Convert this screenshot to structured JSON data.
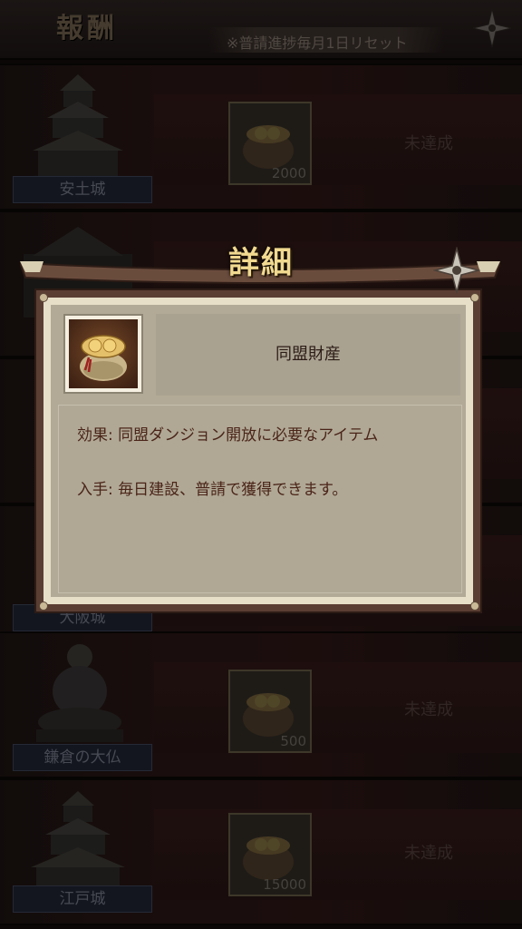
{
  "header": {
    "title": "報酬",
    "notice": "※普請進捗毎月1日リセット"
  },
  "rewards": [
    {
      "place": "安土城",
      "count": "2000",
      "status": "未達成"
    },
    {
      "place": "",
      "count": "",
      "status": ""
    },
    {
      "place": "",
      "count": "",
      "status": ""
    },
    {
      "place": "大阪城",
      "count": "",
      "status": ""
    },
    {
      "place": "鎌倉の大仏",
      "count": "500",
      "status": "未達成"
    },
    {
      "place": "江戸城",
      "count": "15000",
      "status": "未達成"
    }
  ],
  "dialog": {
    "title": "詳細",
    "item_name": "同盟財産",
    "effect": "効果:  同盟ダンジョン開放に必要なアイテム",
    "obtain": "入手:  毎日建設、普請で獲得できます。"
  },
  "colors": {
    "accent_gold": "#f1d990",
    "dialog_bg": "#e7dfc8",
    "text_dark_red": "#4a2418"
  },
  "icons": {
    "close": "shuriken-close-icon",
    "item": "money-bag-icon"
  }
}
